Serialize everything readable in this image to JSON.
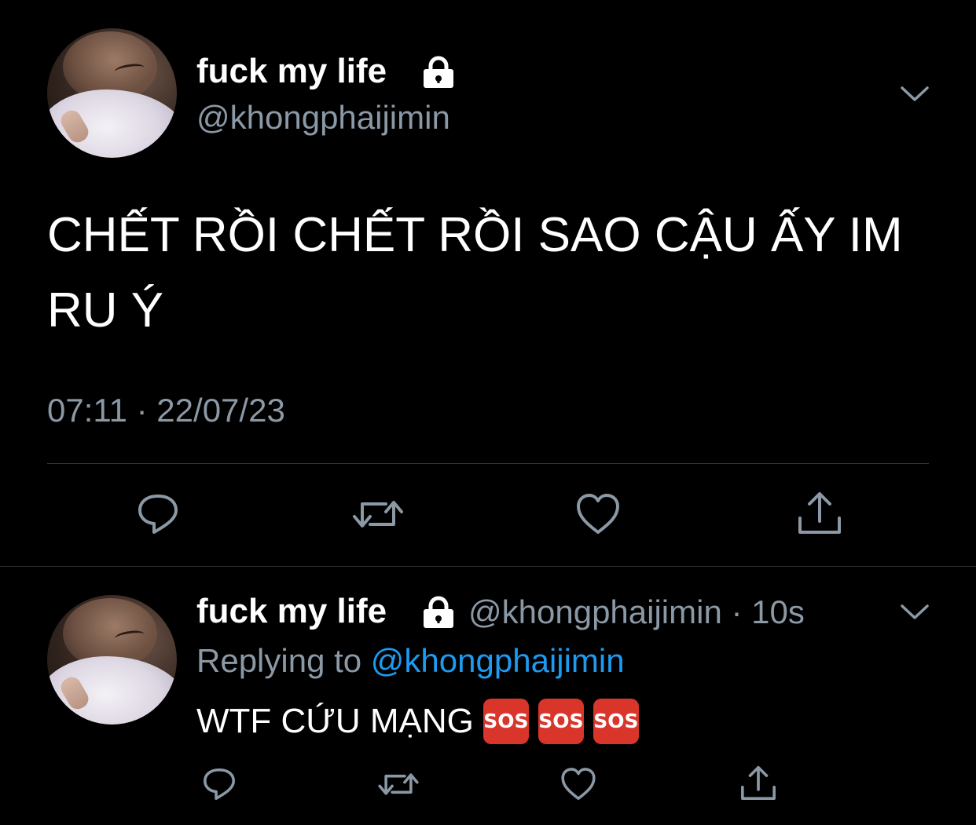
{
  "colors": {
    "background": "#000000",
    "text_primary": "#ffffff",
    "text_secondary": "#8b98a5",
    "mention": "#1d9bf0",
    "divider": "#2f3336",
    "sos_badge": "#d9352b"
  },
  "main_tweet": {
    "display_name": "fuck my life",
    "handle": "@khongphaijimin",
    "text": "CHẾT RỒI CHẾT RỒI SAO CẬU ẤY IM RU Ý",
    "timestamp": "07:11 · 22/07/23",
    "icons": {
      "lock": "lock-icon",
      "more": "chevron-down-icon",
      "reply": "reply-icon",
      "retweet": "retweet-icon",
      "like": "heart-icon",
      "share": "share-icon"
    }
  },
  "reply_tweet": {
    "display_name": "fuck my life",
    "handle": "@khongphaijimin",
    "separator": "·",
    "time_ago": "10s",
    "replying_to_label": "Replying to",
    "replying_to_handle": "@khongphaijimin",
    "text": "WTF CỨU MẠNG",
    "emojis": [
      "SOS",
      "SOS",
      "SOS"
    ]
  }
}
